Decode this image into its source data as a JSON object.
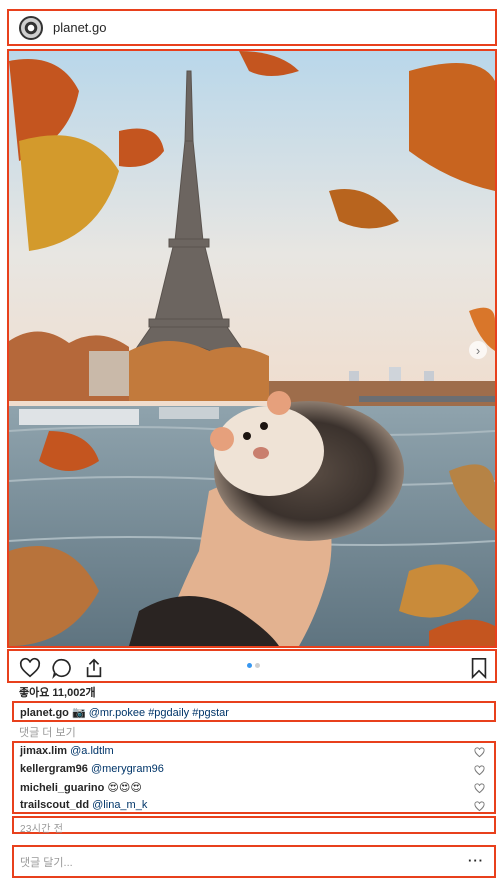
{
  "post": {
    "username": "planet.go",
    "likes_text": "좋아요 11,002개",
    "caption": {
      "username": "planet.go",
      "camera_emoji": "📷",
      "text": "@mr.pokee #pgdaily #pgstar"
    },
    "view_comments": "댓글 더 보기",
    "comments": [
      {
        "username": "jimax.lim",
        "text": "@a.ldtlm"
      },
      {
        "username": "kellergram96",
        "text": "@merygram96"
      },
      {
        "username": "micheli_guarino",
        "text": "😍😍😍"
      },
      {
        "username": "trailscout_dd",
        "text": "@lina_m_k"
      }
    ],
    "timestamp": "23시간 전",
    "comment_placeholder": "댓글 달기...",
    "more_label": "···",
    "carousel": {
      "count": 2,
      "active": 0
    }
  },
  "icons": {
    "avatar": "profile-avatar",
    "like": "heart-icon",
    "comment": "comment-bubble-icon",
    "share": "share-icon",
    "save": "bookmark-icon",
    "next": "chevron-right-icon"
  },
  "colors": {
    "highlight_border": "#e8401c",
    "link": "#003569",
    "muted": "#999999",
    "active_dot": "#3897f0"
  }
}
